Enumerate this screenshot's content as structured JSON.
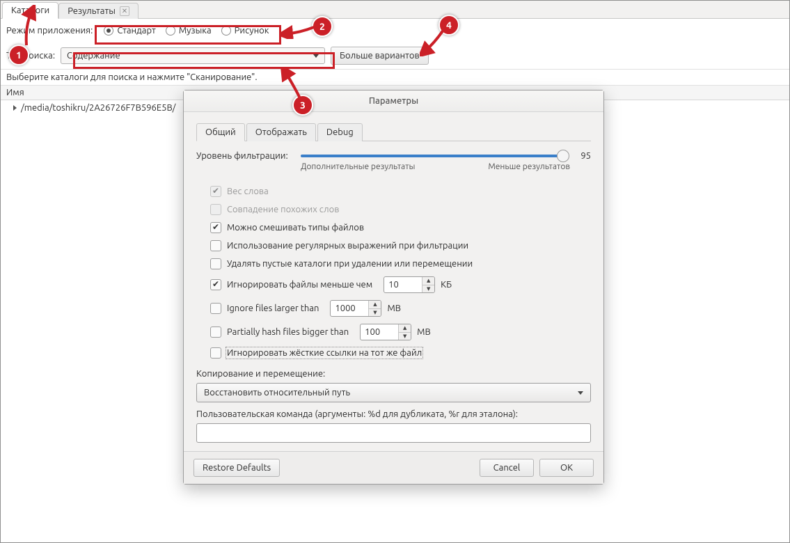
{
  "tabs": {
    "catalogs": "Каталоги",
    "results": "Результаты"
  },
  "toolbar": {
    "mode_label": "Режим приложения:",
    "radio_standard": "Стандарт",
    "radio_music": "Музыка",
    "radio_picture": "Рисунок",
    "search_label": "Тип поиска:",
    "search_value": "Содержание",
    "more_options": "Больше вариантов"
  },
  "instruction": "Выберите каталоги для поиска и нажмите \"Сканирование\".",
  "table": {
    "col_name": "Имя",
    "row0": "/media/toshikru/2A26726F7B596E5B/"
  },
  "dialog": {
    "title": "Параметры",
    "tabs": {
      "general": "Общий",
      "display": "Отображать",
      "debug": "Debug"
    },
    "filter_label": "Уровень фильтрации:",
    "filter_value": "95",
    "caption_more": "Дополнительные результаты",
    "caption_less": "Меньше результатов",
    "chk_word_weight": "Вес слова",
    "chk_similar": "Совпадение похожих слов",
    "chk_mix_types": "Можно смешивать типы файлов",
    "chk_regex": "Использование регулярных выражений при фильтрации",
    "chk_del_empty": "Удалять пустые каталоги при удалении или перемещении",
    "chk_ignore_small": "Игнорировать файлы меньше чем",
    "ignore_small_val": "10",
    "ignore_small_unit": "КБ",
    "chk_ignore_large": "Ignore files larger than",
    "ignore_large_val": "1000",
    "ignore_large_unit": "MB",
    "chk_partial_hash": "Partially hash files bigger than",
    "partial_hash_val": "100",
    "partial_hash_unit": "MB",
    "chk_ignore_hardlinks": "Игнорировать жёсткие ссылки на тот же файл",
    "copy_section": "Копирование и перемещение:",
    "copy_select": "Восстановить относительный путь",
    "cmd_label": "Пользовательская команда (аргументы: %d для дубликата, %r для эталона):",
    "btn_restore": "Restore Defaults",
    "btn_cancel": "Cancel",
    "btn_ok": "OK"
  },
  "annotations": {
    "b1": "1",
    "b2": "2",
    "b3": "3",
    "b4": "4"
  }
}
